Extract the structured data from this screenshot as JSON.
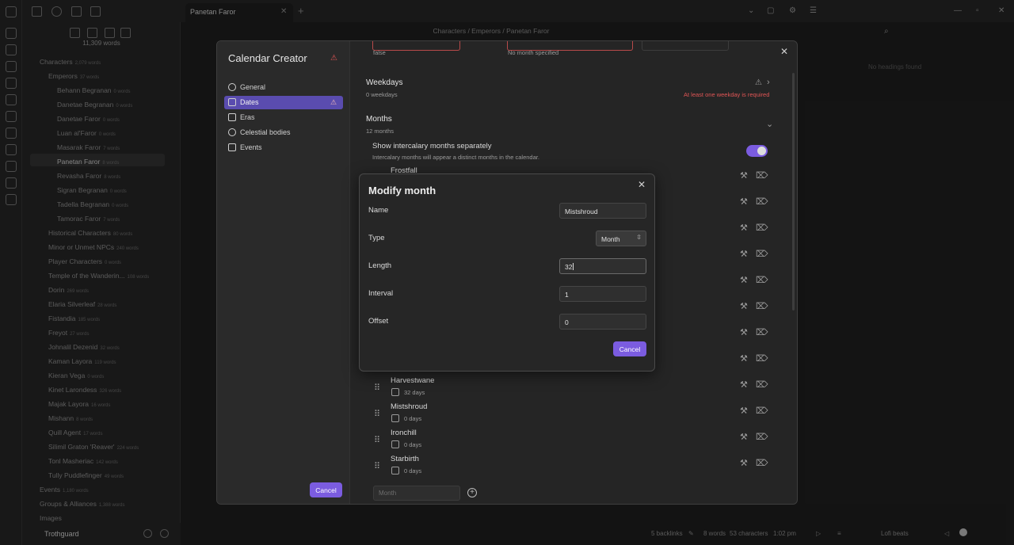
{
  "tab": {
    "title": "Panetan Faror"
  },
  "breadcrumb": "Characters / Emperors / Panetan Faror",
  "sidebar": {
    "word_count": "11,309 words",
    "tree": [
      {
        "label": "Characters",
        "words": "2,079 words",
        "level": 0
      },
      {
        "label": "Emperors",
        "words": "37 words",
        "level": 1
      },
      {
        "label": "Behann Begranan",
        "words": "0 words",
        "level": 2
      },
      {
        "label": "Danetae Begranan",
        "words": "0 words",
        "level": 2
      },
      {
        "label": "Danetae Faror",
        "words": "0 words",
        "level": 2
      },
      {
        "label": "Luan al'Faror",
        "words": "0 words",
        "level": 2
      },
      {
        "label": "Masarak Faror",
        "words": "7 words",
        "level": 2
      },
      {
        "label": "Panetan Faror",
        "words": "8 words",
        "level": 2
      },
      {
        "label": "Revasha Faror",
        "words": "8 words",
        "level": 2
      },
      {
        "label": "Sigran Begranan",
        "words": "0 words",
        "level": 2
      },
      {
        "label": "Tadella Begranan",
        "words": "0 words",
        "level": 2
      },
      {
        "label": "Tamorac Faror",
        "words": "7 words",
        "level": 2
      },
      {
        "label": "Historical Characters",
        "words": "80 words",
        "level": 1
      },
      {
        "label": "Minor or Unmet NPCs",
        "words": "240 words",
        "level": 1
      },
      {
        "label": "Player Characters",
        "words": "0 words",
        "level": 1
      },
      {
        "label": "Temple of the Wanderin...",
        "words": "108 words",
        "level": 1
      },
      {
        "label": "Dorin",
        "words": "269 words",
        "level": 1
      },
      {
        "label": "Elaria Silverleaf",
        "words": "28 words",
        "level": 1
      },
      {
        "label": "Fistandia",
        "words": "185 words",
        "level": 1
      },
      {
        "label": "Freyot",
        "words": "27 words",
        "level": 1
      },
      {
        "label": "Johnalil Dezenid",
        "words": "32 words",
        "level": 1
      },
      {
        "label": "Kaman Layora",
        "words": "119 words",
        "level": 1
      },
      {
        "label": "Kieran Vega",
        "words": "0 words",
        "level": 1
      },
      {
        "label": "Kinet Larondess",
        "words": "326 words",
        "level": 1
      },
      {
        "label": "Majak Layora",
        "words": "16 words",
        "level": 1
      },
      {
        "label": "Mishann",
        "words": "8 words",
        "level": 1
      },
      {
        "label": "Quill Agent",
        "words": "17 words",
        "level": 1
      },
      {
        "label": "Silimil Graton 'Reaver'",
        "words": "224 words",
        "level": 1
      },
      {
        "label": "Tonl Masheriac",
        "words": "142 words",
        "level": 1
      },
      {
        "label": "Tully Puddlefinger",
        "words": "49 words",
        "level": 1
      },
      {
        "label": "Events",
        "words": "1,180 words",
        "level": 0
      },
      {
        "label": "Groups & Alliances",
        "words": "1,388 words",
        "level": 0
      },
      {
        "label": "Images",
        "words": "",
        "level": 0
      }
    ],
    "vault_name": "Trothguard"
  },
  "right_panel_note": "No headings found",
  "statusbar": {
    "backlinks": "5 backlinks",
    "words": "8 words",
    "characters": "53 characters",
    "time": "1:02 pm",
    "music": "Lofi beats"
  },
  "calendar_creator": {
    "title": "Calendar Creator",
    "nav": [
      {
        "label": "General",
        "active": false,
        "warn": false
      },
      {
        "label": "Dates",
        "active": true,
        "warn": true
      },
      {
        "label": "Eras",
        "active": false,
        "warn": false
      },
      {
        "label": "Celestial bodies",
        "active": false,
        "warn": false
      },
      {
        "label": "Events",
        "active": false,
        "warn": false
      }
    ],
    "cancel_label": "Cancel",
    "top_field_values": {
      "left": "false",
      "right": "No month specified"
    },
    "weekdays": {
      "title": "Weekdays",
      "count": "0 weekdays",
      "warning": "At least one weekday is required"
    },
    "months": {
      "title": "Months",
      "count": "12 months",
      "intercalary_label": "Show intercalary months separately",
      "intercalary_desc": "Intercalary months will appear a distinct months in the calendar.",
      "intercalary_on": true,
      "first_visible": "Frostfall",
      "rows": [
        {
          "name": "Harvestwane",
          "days": "32 days"
        },
        {
          "name": "Mistshroud",
          "days": "0 days"
        },
        {
          "name": "Ironchill",
          "days": "0 days"
        },
        {
          "name": "Starbirth",
          "days": "0 days"
        }
      ],
      "new_month_placeholder": "Month"
    }
  },
  "modify_month": {
    "title": "Modify month",
    "name_label": "Name",
    "name_value": "Mistshroud",
    "type_label": "Type",
    "type_value": "Month",
    "length_label": "Length",
    "length_value": "32",
    "interval_label": "Interval",
    "interval_value": "1",
    "offset_label": "Offset",
    "offset_value": "0",
    "cancel_label": "Cancel"
  },
  "colors": {
    "accent": "#7b5ce0",
    "nav_active": "#5a4caf",
    "warning": "#e05555",
    "background": "#1e1e1e"
  }
}
